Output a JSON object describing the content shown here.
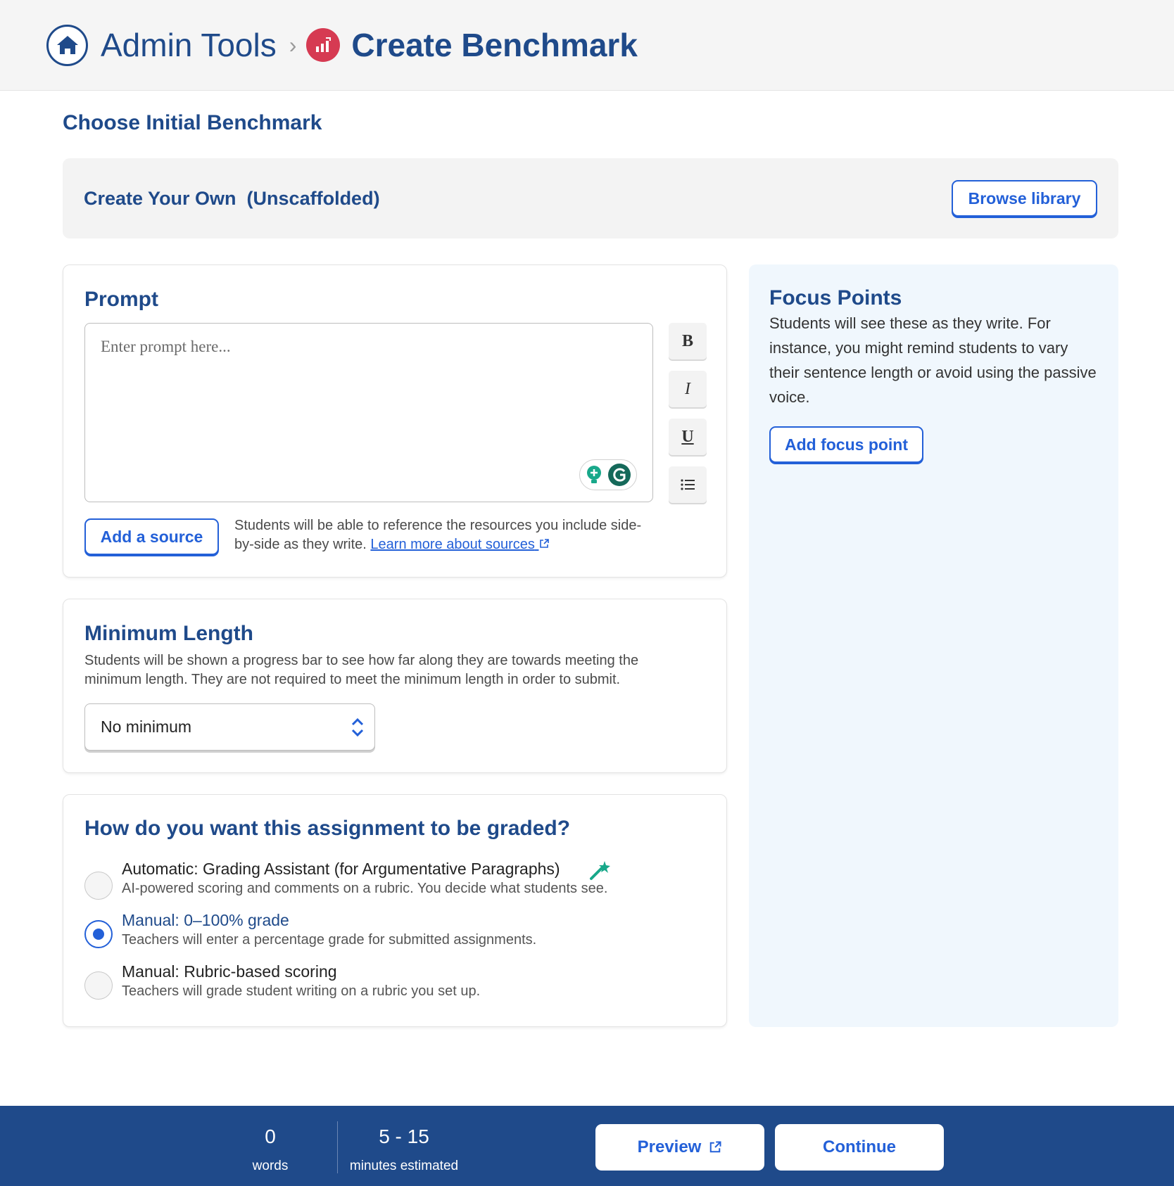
{
  "header": {
    "breadcrumb_parent": "Admin Tools",
    "breadcrumb_current": "Create Benchmark",
    "home_icon": "home-icon",
    "benchmark_icon": "bar-chart-icon"
  },
  "section_title": "Choose Initial Benchmark",
  "create_own": {
    "title": "Create Your Own  (Unscaffolded)",
    "browse_label": "Browse library"
  },
  "prompt": {
    "title": "Prompt",
    "placeholder": "Enter prompt here...",
    "format_buttons": [
      "B",
      "I",
      "U"
    ],
    "add_source_label": "Add a source",
    "source_help": "Students will be able to reference the resources you include side-by-side as they write.",
    "source_link": "Learn more about sources"
  },
  "min_length": {
    "title": "Minimum Length",
    "description": "Students will be shown a progress bar to see how far along they are towards meeting the minimum length. They are not required to meet the minimum length in order to submit.",
    "selected": "No minimum"
  },
  "grading": {
    "title": "How do you want this assignment to be graded?",
    "options": [
      {
        "title": "Automatic: Grading Assistant (for Argumentative Paragraphs)",
        "desc": "AI-powered scoring and comments on a rubric. You decide what students see.",
        "checked": false
      },
      {
        "title": "Manual: 0–100% grade",
        "desc": "Teachers will enter a percentage grade for submitted assignments.",
        "checked": true
      },
      {
        "title": "Manual: Rubric-based scoring",
        "desc": "Teachers will grade student writing on a rubric you set up.",
        "checked": false
      }
    ]
  },
  "focus": {
    "title": "Focus Points",
    "description": "Students will see these as they write. For instance, you might remind students to vary their sentence length or avoid using the passive voice.",
    "add_label": "Add focus point"
  },
  "footer": {
    "words_count": "0",
    "words_label": "words",
    "minutes_range": "5 - 15",
    "minutes_label": "minutes estimated",
    "preview_label": "Preview",
    "continue_label": "Continue"
  },
  "colors": {
    "navy": "#1f4a8a",
    "accent": "#2360d8",
    "benchmark_red": "#d63a52",
    "focus_bg": "#f0f7fd"
  }
}
